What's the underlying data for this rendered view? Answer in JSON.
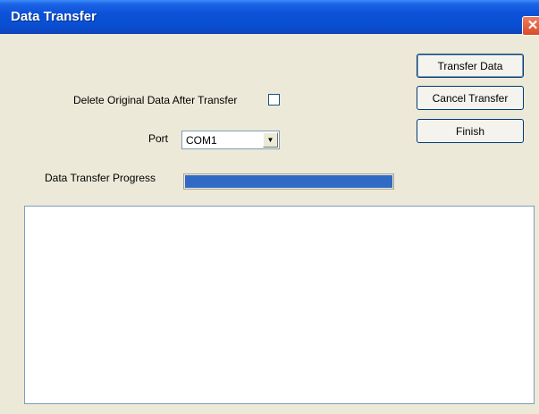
{
  "window": {
    "title": "Data Transfer",
    "close_glyph": "✕"
  },
  "form": {
    "delete_label": "Delete Original Data After Transfer",
    "delete_checked": false,
    "port_label": "Port",
    "port_value": "COM1",
    "port_arrow_glyph": "▼",
    "progress_label": "Data Transfer Progress",
    "progress_value": 1.0
  },
  "buttons": {
    "transfer_data": "Transfer Data",
    "cancel_transfer": "Cancel Transfer",
    "finish": "Finish"
  },
  "log": {
    "text": ""
  },
  "colors": {
    "titlebar": "#0a4fd3",
    "progress_fill": "#316ac5",
    "close_button": "#d84b2a",
    "face": "#ece9d8"
  }
}
